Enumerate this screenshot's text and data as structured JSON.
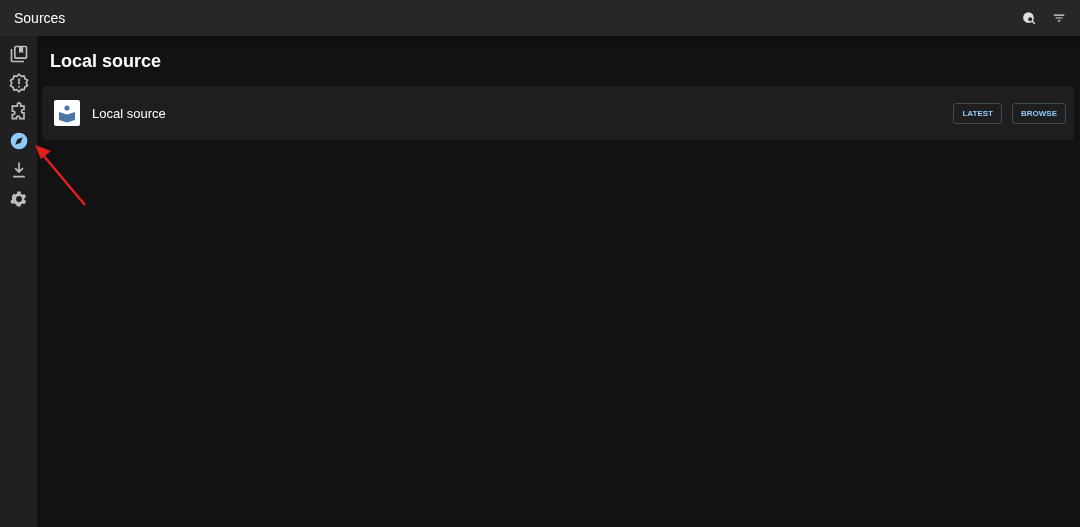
{
  "app_bar": {
    "title": "Sources",
    "actions": [
      {
        "kind": "globe-search"
      },
      {
        "kind": "filter"
      }
    ]
  },
  "sidebar": {
    "items": [
      {
        "kind": "library",
        "selected": false
      },
      {
        "kind": "updates",
        "selected": false
      },
      {
        "kind": "extensions",
        "selected": false
      },
      {
        "kind": "browse",
        "selected": true
      },
      {
        "kind": "downloads",
        "selected": false
      },
      {
        "kind": "settings",
        "selected": false
      }
    ]
  },
  "heading": "Local source",
  "sources": [
    {
      "name": "Local source",
      "buttons": [
        "LATEST",
        "BROWSE"
      ]
    }
  ]
}
